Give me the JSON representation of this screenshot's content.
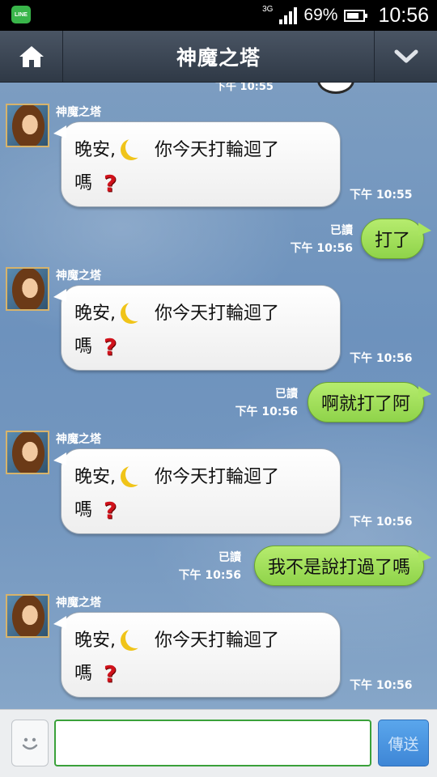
{
  "status_bar": {
    "network": "3G",
    "battery": "69%",
    "time": "10:56",
    "app_icon_label": "LINE"
  },
  "header": {
    "title": "神魔之塔",
    "home_icon": "home-icon",
    "menu_icon": "chevron-down-icon"
  },
  "chat": {
    "top_partial_time": "下午 10:55",
    "messages": [
      {
        "direction": "in",
        "sender": "神魔之塔",
        "line1_a": "晚安,",
        "line1_b": "你今天打輪迴了",
        "line2": "嗎",
        "time": "下午 10:55"
      },
      {
        "direction": "out",
        "read": "已讀",
        "text": "打了",
        "time": "下午 10:56"
      },
      {
        "direction": "in",
        "sender": "神魔之塔",
        "line1_a": "晚安,",
        "line1_b": "你今天打輪迴了",
        "line2": "嗎",
        "time": "下午 10:56"
      },
      {
        "direction": "out",
        "read": "已讀",
        "text": "啊就打了阿",
        "time": "下午 10:56"
      },
      {
        "direction": "in",
        "sender": "神魔之塔",
        "line1_a": "晚安,",
        "line1_b": "你今天打輪迴了",
        "line2": "嗎",
        "time": "下午 10:56"
      },
      {
        "direction": "out",
        "read": "已讀",
        "text": "我不是說打過了嗎",
        "time": "下午 10:56"
      },
      {
        "direction": "in",
        "sender": "神魔之塔",
        "line1_a": "晚安,",
        "line1_b": "你今天打輪迴了",
        "line2": "嗎",
        "time": "下午 10:56"
      }
    ]
  },
  "input_bar": {
    "value": "",
    "send_label": "傳送",
    "emoji_icon": "smiley-icon"
  },
  "colors": {
    "header": "#3a4452",
    "chat_bg": "#7499c0",
    "out_bubble": "#a3e15a",
    "in_bubble": "#ffffff",
    "send_button": "#4a96e2"
  }
}
